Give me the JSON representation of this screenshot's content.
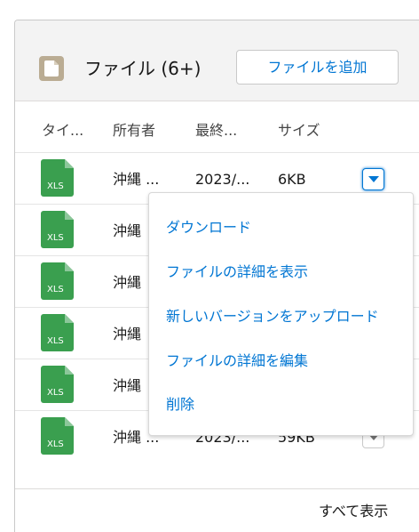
{
  "header": {
    "title": "ファイル (6+)",
    "add_button": "ファイルを追加",
    "icon": "files-icon"
  },
  "columns": [
    "タイ...",
    "所有者",
    "最終...",
    "サイズ"
  ],
  "rows": [
    {
      "type": "XLS",
      "owner": "沖縄 ...",
      "modified": "2023/...",
      "size": "6KB"
    },
    {
      "type": "XLS",
      "owner": "沖縄",
      "modified": "",
      "size": ""
    },
    {
      "type": "XLS",
      "owner": "沖縄",
      "modified": "",
      "size": ""
    },
    {
      "type": "XLS",
      "owner": "沖縄",
      "modified": "",
      "size": ""
    },
    {
      "type": "XLS",
      "owner": "沖縄",
      "modified": "",
      "size": ""
    },
    {
      "type": "XLS",
      "owner": "沖縄 ...",
      "modified": "2023/...",
      "size": "59KB"
    }
  ],
  "menu": [
    "ダウンロード",
    "ファイルの詳細を表示",
    "新しいバージョンをアップロード",
    "ファイルの詳細を編集",
    "削除"
  ],
  "footer": {
    "view_all": "すべて表示"
  },
  "colors": {
    "accent": "#0176d3",
    "xls_green": "#3a9f4f",
    "header_bg": "#f3f3f3",
    "files_icon": "#baac93"
  }
}
